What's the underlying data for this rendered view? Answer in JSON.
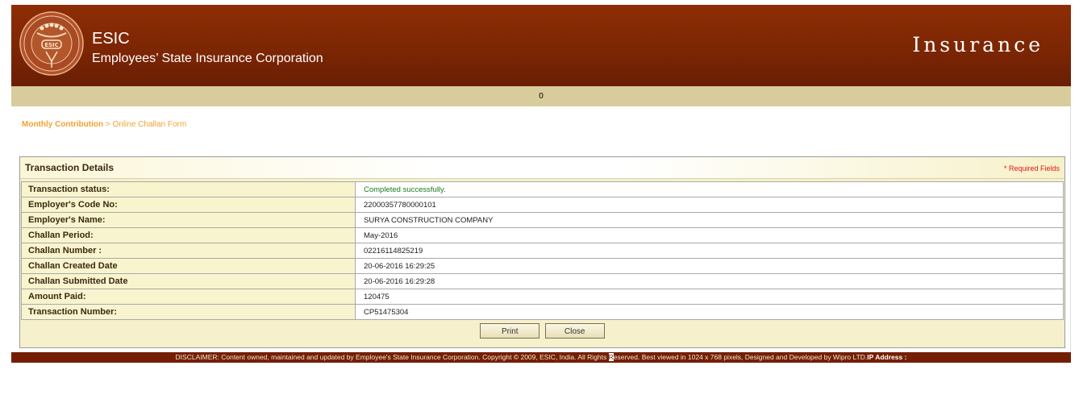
{
  "header": {
    "logo_text": "ESIC",
    "title": "ESIC",
    "subtitle": "Employees’ State Insurance Corporation",
    "section": "Insurance",
    "colors": {
      "header_brown": "#7c2604",
      "counter_bar": "#d8cc9c"
    }
  },
  "counter": "0",
  "breadcrumb": {
    "root": "Monthly Contribution",
    "separator": " > ",
    "current": "Online Challan Form"
  },
  "panel": {
    "title": "Transaction Details",
    "required_note": "* Required Fields",
    "rows": [
      {
        "label": "Transaction status:",
        "value": "Completed successfully."
      },
      {
        "label": "Employer's Code No:",
        "value": "22000357780000101"
      },
      {
        "label": "Employer's Name:",
        "value": "SURYA CONSTRUCTION COMPANY"
      },
      {
        "label": "Challan Period:",
        "value": "May-2016"
      },
      {
        "label": "Challan Number :",
        "value": "02216114825219"
      },
      {
        "label": "Challan Created Date",
        "value": "20-06-2016 16:29:25"
      },
      {
        "label": "Challan Submitted Date",
        "value": "20-06-2016 16:29:28"
      },
      {
        "label": "Amount Paid:",
        "value": "120475"
      },
      {
        "label": "Transaction Number:",
        "value": "CP51475304"
      }
    ],
    "buttons": {
      "print": "Print",
      "close": "Close"
    }
  },
  "footer": {
    "disclaimer_a": "DISCLAIMER: Content owned, maintained and updated by Employee's State Insurance Corporation. Copyright © 2009, ESIC, India. All Rights ",
    "disclaimer_gap": "R",
    "disclaimer_b": "eserved. Best viewed in 1024 x 768 pixels, Designed and Developed by Wipro LTD.",
    "ip_label": "IP Address :"
  }
}
